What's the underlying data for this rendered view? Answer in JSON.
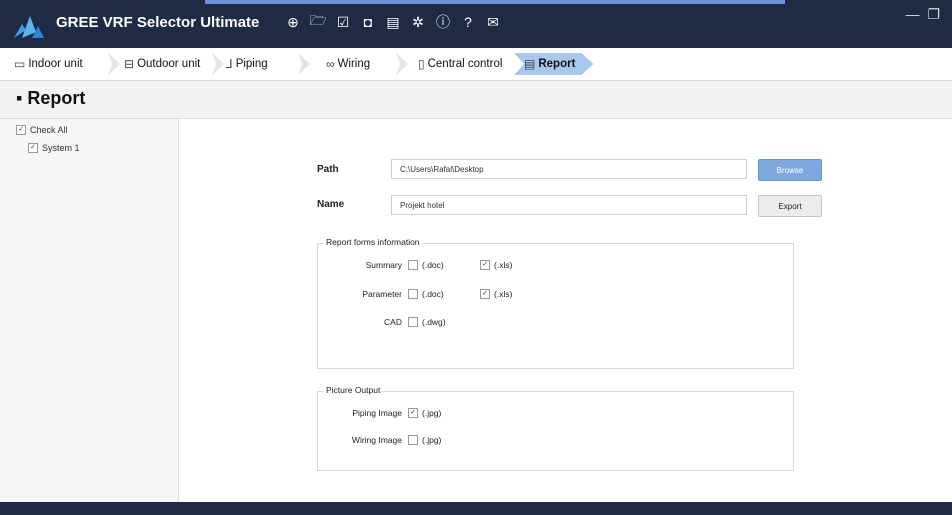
{
  "app": {
    "title": "GREE VRF Selector Ultimate",
    "toolbar_icons": [
      "add-icon",
      "folder-open-icon",
      "edit-icon",
      "save-icon",
      "calculator-icon",
      "settings-icon",
      "info-icon",
      "help-icon",
      "mail-icon"
    ],
    "toolbar_glyphs": [
      "⊕",
      "🗁",
      "☑",
      "◘",
      "▤",
      "✲",
      "ⓘ",
      "?",
      "✉"
    ]
  },
  "tabs": [
    {
      "label": "Indoor unit",
      "icon": "▭"
    },
    {
      "label": "Outdoor unit",
      "icon": "⊟"
    },
    {
      "label": "Piping",
      "icon": "⅃"
    },
    {
      "label": "Wiring",
      "icon": "∞"
    },
    {
      "label": "Central control",
      "icon": "▯"
    },
    {
      "label": "Report",
      "icon": "▤"
    }
  ],
  "page_title": "Report",
  "tree": {
    "check_all": "Check All",
    "systems": [
      "System 1"
    ]
  },
  "form": {
    "path_label": "Path",
    "path_value": "C:\\Users\\Rafal\\Desktop",
    "browse_label": "Browse",
    "name_label": "Name",
    "name_value": "Projekt hotel",
    "export_label": "Export"
  },
  "report_forms": {
    "title": "Report forms information",
    "rows": [
      {
        "label": "Summary",
        "opt1": "(.doc)",
        "opt1_checked": false,
        "opt2": "(.xls)",
        "opt2_checked": true
      },
      {
        "label": "Parameter",
        "opt1": "(.doc)",
        "opt1_checked": false,
        "opt2": "(.xls)",
        "opt2_checked": true
      },
      {
        "label": "CAD",
        "opt1": "(.dwg)",
        "opt1_checked": false
      }
    ]
  },
  "picture_output": {
    "title": "Picture Output",
    "rows": [
      {
        "label": "Piping Image",
        "opt": "(.jpg)",
        "checked": true
      },
      {
        "label": "Wiring Image",
        "opt": "(.jpg)",
        "checked": false
      }
    ]
  },
  "colors": {
    "titlebar": "#1f2a44",
    "active_tab": "#a8c8ef",
    "browse_button": "#7fa7e0"
  }
}
